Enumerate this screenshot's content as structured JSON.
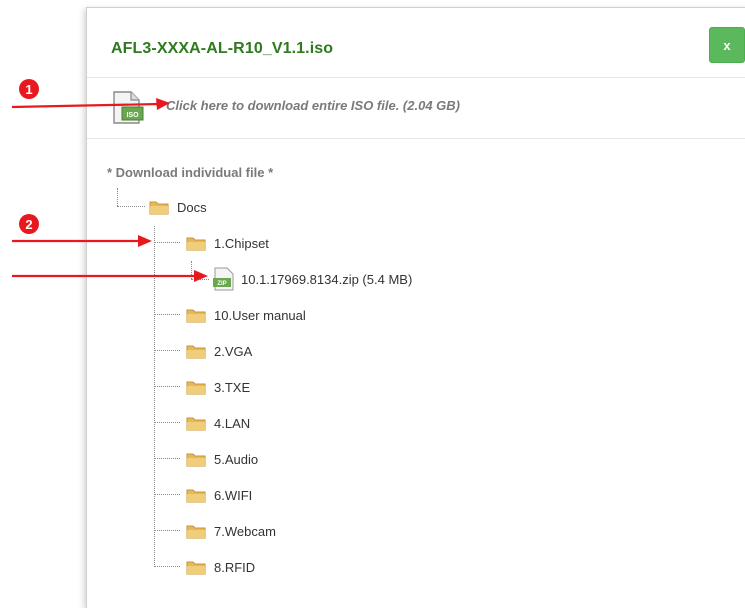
{
  "modal": {
    "title": "AFL3-XXXA-AL-R10_V1.1.iso",
    "close_label": "x",
    "iso_link": "Click here to download entire ISO file. (2.04 GB)",
    "section_heading": "* Download individual file *"
  },
  "tree": {
    "root": {
      "label": "Docs",
      "icon": "folder-icon"
    },
    "folders": [
      {
        "label": "1.Chipset",
        "icon": "folder-icon",
        "expanded": true
      },
      {
        "label": "10.User manual",
        "icon": "folder-icon"
      },
      {
        "label": "2.VGA",
        "icon": "folder-icon"
      },
      {
        "label": "3.TXE",
        "icon": "folder-icon"
      },
      {
        "label": "4.LAN",
        "icon": "folder-icon"
      },
      {
        "label": "5.Audio",
        "icon": "folder-icon"
      },
      {
        "label": "6.WIFI",
        "icon": "folder-icon"
      },
      {
        "label": "7.Webcam",
        "icon": "folder-icon"
      },
      {
        "label": "8.RFID",
        "icon": "folder-icon"
      }
    ],
    "chipset_file": {
      "label": "10.1.17969.8134.zip (5.4 MB)",
      "icon": "zip-file-icon",
      "icon_text": "ZIP"
    }
  },
  "annotations": [
    {
      "number": "1"
    },
    {
      "number": "2"
    }
  ],
  "colors": {
    "title": "#2d7a1f",
    "close_button": "#5cb85c",
    "arrow": "#e8191e",
    "folder": "#e5b85a"
  }
}
